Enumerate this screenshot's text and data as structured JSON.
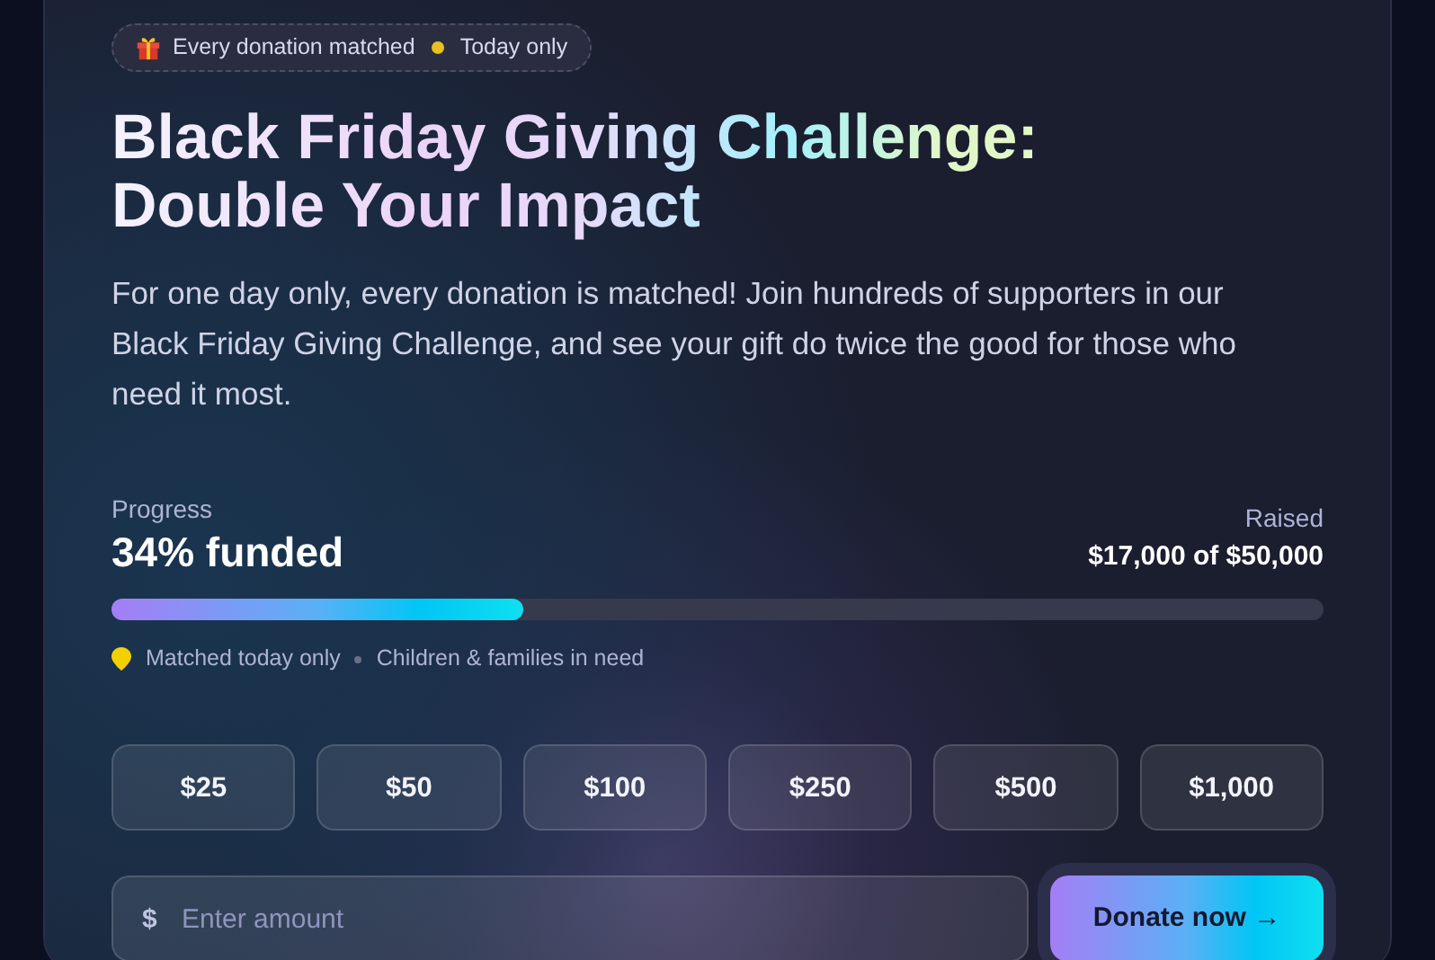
{
  "badge": {
    "parts": [
      "Every donation matched",
      "Today only"
    ]
  },
  "title": "Black Friday Giving Challenge: Double Your Impact",
  "description": "For one day only, every donation is matched! Join hundreds of supporters in our Black Friday Giving Challenge, and see your gift do twice the good for those who need it most.",
  "progress": {
    "label": "Progress",
    "value": "34% funded",
    "raised_label": "Raised",
    "raised": "$17,000 of $50,000",
    "level": 0.34
  },
  "meta": [
    "Matched today only",
    "Children & families in need"
  ],
  "amounts": [
    {
      "label": "$25"
    },
    {
      "label": "$50"
    },
    {
      "label": "$100"
    },
    {
      "label": "$250"
    },
    {
      "label": "$500"
    },
    {
      "label": "$1,000"
    }
  ],
  "amount_field": {
    "prefix": "$",
    "placeholder": "Enter amount"
  },
  "donate_button": "Donate now →"
}
